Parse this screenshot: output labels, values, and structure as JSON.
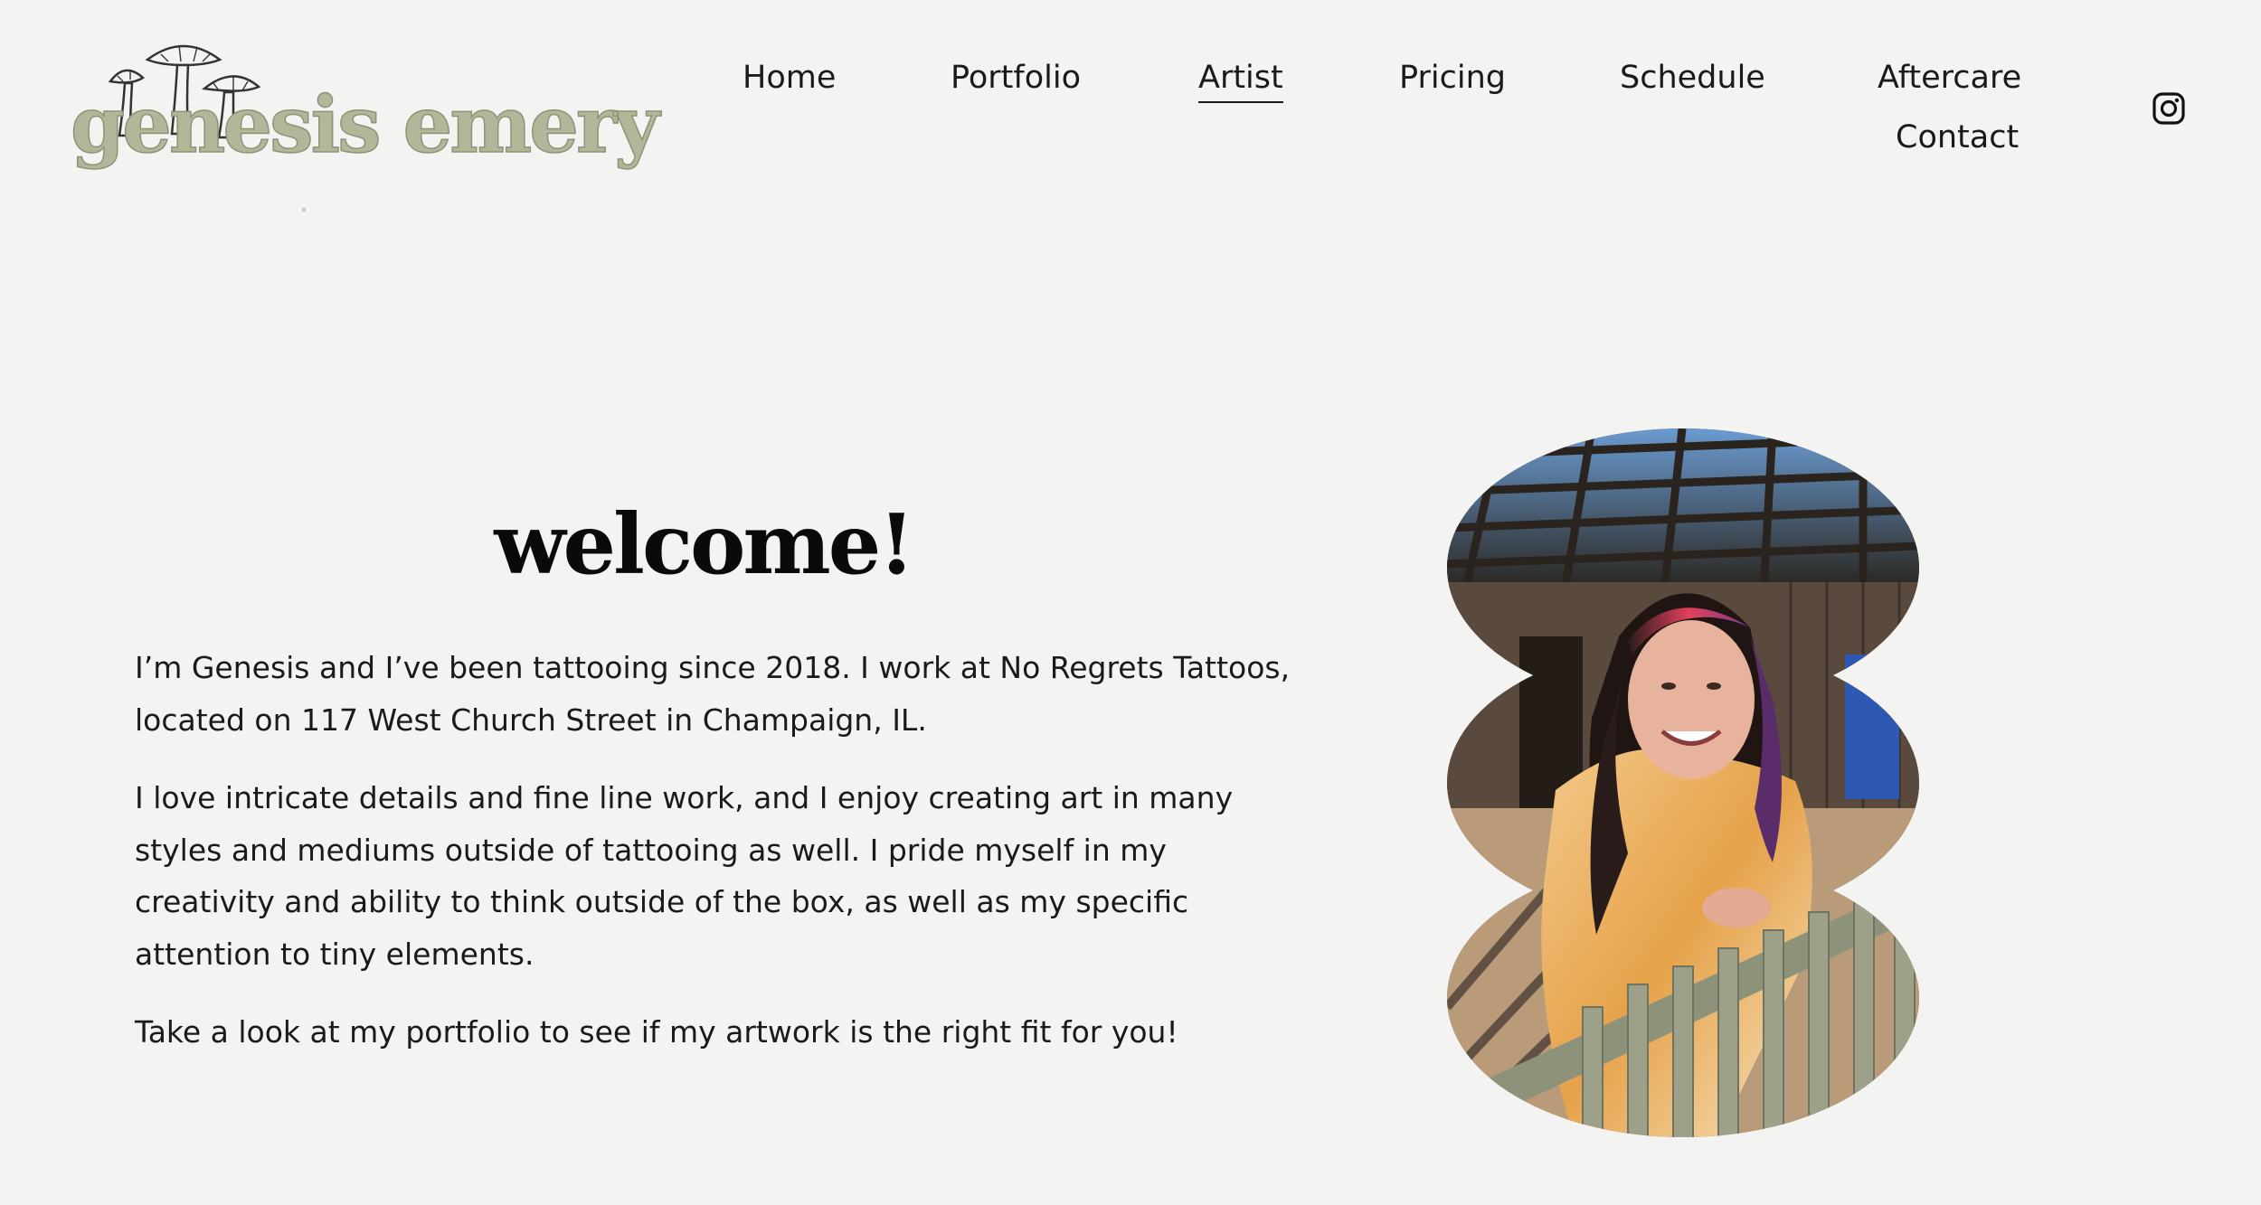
{
  "brand": {
    "logo_text": "genesis emery",
    "logo_color": "#b2b79a",
    "logo_icon": "mushrooms-icon"
  },
  "nav": {
    "items": [
      {
        "label": "Home"
      },
      {
        "label": "Portfolio"
      },
      {
        "label": "Artist",
        "active": true
      },
      {
        "label": "Pricing"
      },
      {
        "label": "Schedule"
      },
      {
        "label": "Aftercare"
      },
      {
        "label": "Contact"
      }
    ],
    "social_icon": "instagram-icon"
  },
  "main": {
    "heading": "welcome!",
    "paragraphs": [
      "I’m Genesis and I’ve been tattooing since 2018. I work at No Regrets Tattoos, located on 117 West Church Street in Champaign, IL.",
      "I love intricate details and fine line work, and I enjoy creating art in many styles and mediums outside of tattooing as well. I pride myself in my creativity and ability to think outside of the box, as well as my specific attention to tiny elements.",
      "Take a look at my portfolio to see if my artwork is the right fit for you!"
    ],
    "photo_icon": "artist-portrait-photo"
  },
  "colors": {
    "background": "#f3f3f1",
    "text": "#1a1a1a"
  }
}
